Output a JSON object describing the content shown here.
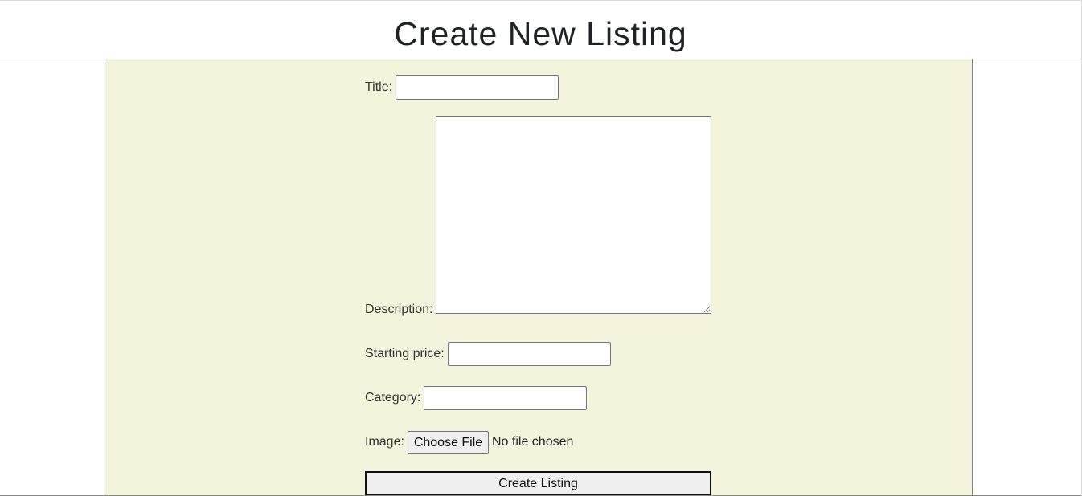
{
  "header": {
    "title": "Create New Listing"
  },
  "form": {
    "title_label": "Title:",
    "title_value": "",
    "description_label": "Description:",
    "description_value": "",
    "starting_price_label": "Starting price:",
    "starting_price_value": "",
    "category_label": "Category:",
    "category_value": "",
    "image_label": "Image:",
    "choose_file_label": "Choose File",
    "no_file_text": "No file chosen",
    "submit_label": "Create Listing"
  },
  "colors": {
    "form_background": "#f4f4dc",
    "page_background": "#ffffff"
  }
}
